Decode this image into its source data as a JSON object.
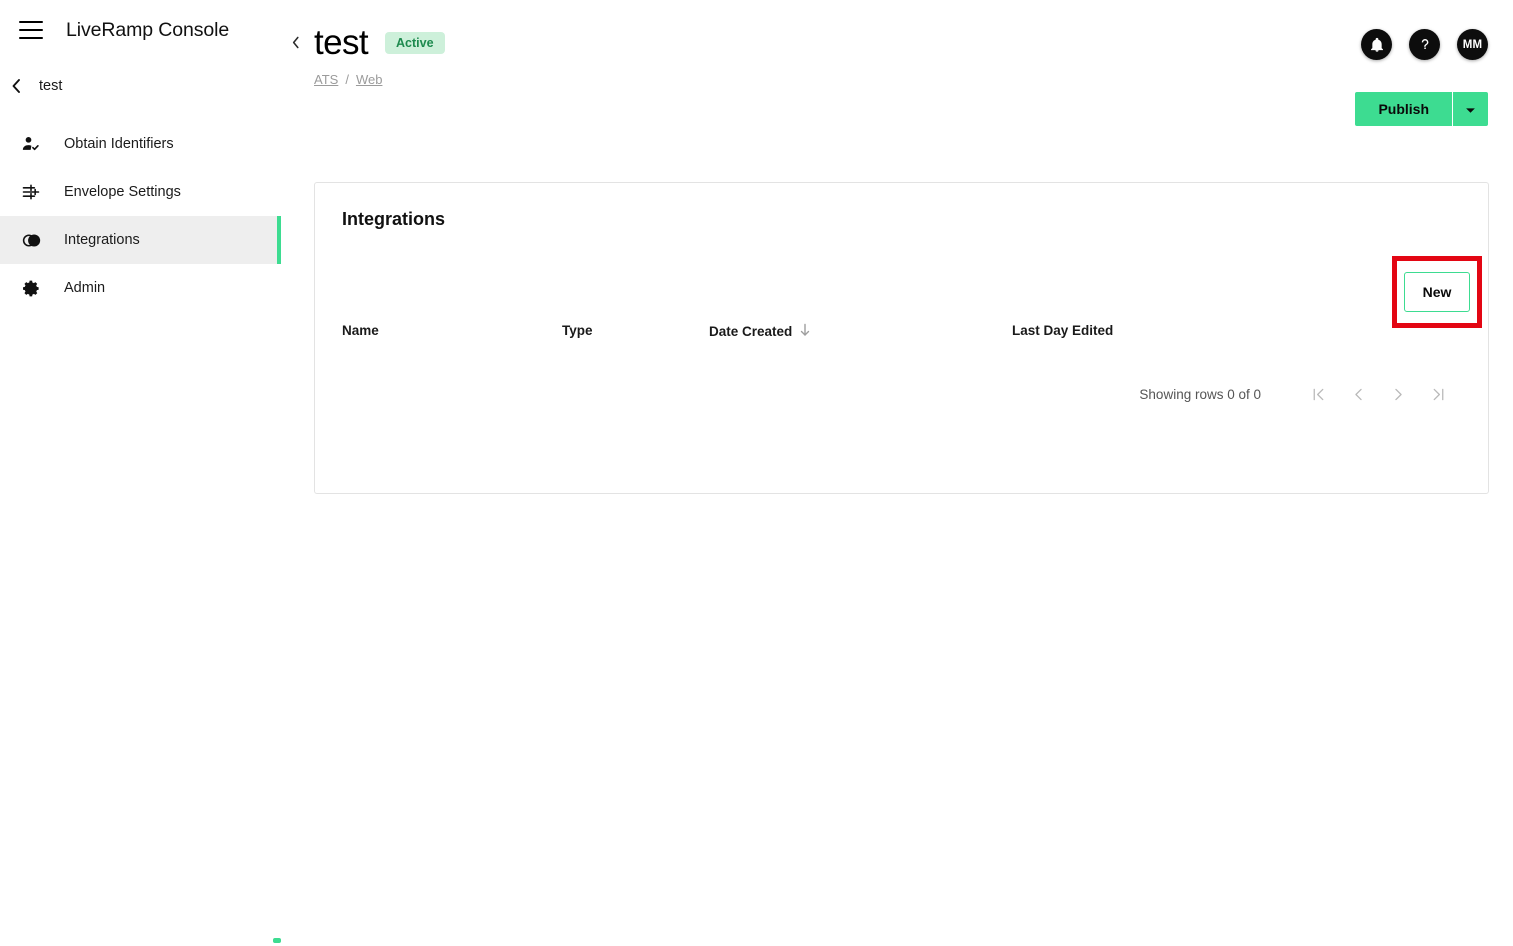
{
  "sidebar": {
    "menu_icon": "hamburger-icon",
    "brand": "LiveRamp Console",
    "back": {
      "icon": "chevron-left-icon",
      "label": "test"
    },
    "items": [
      {
        "label": "Obtain Identifiers",
        "icon": "person-check-icon",
        "active": false
      },
      {
        "label": "Envelope Settings",
        "icon": "tune-sliders-icon",
        "active": false
      },
      {
        "label": "Integrations",
        "icon": "overlapping-circles-icon",
        "active": true
      },
      {
        "label": "Admin",
        "icon": "gear-icon",
        "active": false
      }
    ],
    "collapse_icon": "chevron-left-icon",
    "accent_color": "#3ddc91"
  },
  "header": {
    "title": "test",
    "status": "Active",
    "status_bg": "#cdf0da",
    "status_color": "#1d8a4e",
    "breadcrumb": {
      "first": "ATS",
      "separator": "/",
      "second": "Web"
    },
    "icons": [
      {
        "name": "notification-bell-icon",
        "glyph": "🔔"
      },
      {
        "name": "help-question-icon",
        "glyph": "?"
      }
    ],
    "avatar": "MM",
    "publish_label": "Publish",
    "publish_color": "#3ddc91",
    "publish_caret_icon": "caret-down-icon"
  },
  "card": {
    "title": "Integrations",
    "new_label": "New",
    "highlight_color": "#e30613",
    "table": {
      "columns": [
        {
          "label": "Name",
          "sorted": false
        },
        {
          "label": "Type",
          "sorted": false
        },
        {
          "label": "Date Created",
          "sorted": true,
          "sort_icon": "arrow-down-icon"
        },
        {
          "label": "Last Day Edited",
          "sorted": false
        }
      ],
      "rows": []
    },
    "pagination": {
      "showing": "Showing rows 0 of 0",
      "first_icon": "first-page-icon",
      "prev_icon": "chevron-left-icon",
      "next_icon": "chevron-right-icon",
      "last_icon": "last-page-icon"
    }
  }
}
